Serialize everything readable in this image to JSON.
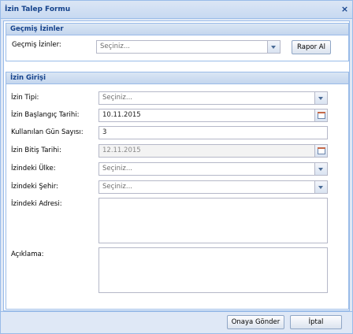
{
  "window": {
    "title": "İzin Talep Formu",
    "close_glyph": "×"
  },
  "past": {
    "section_title": "Geçmiş İzinler",
    "label": "Geçmiş İzinler:",
    "placeholder": "Seçiniz...",
    "report_button": "Rapor Al"
  },
  "entry": {
    "section_title": "İzin Girişi",
    "leave_type_label": "İzin Tipi:",
    "leave_type_value": "Seçiniz...",
    "start_date_label": "İzin Başlangıç Tarihi:",
    "start_date_value": "10.11.2015",
    "days_label": "Kullanılan Gün Sayısı:",
    "days_value": "3",
    "end_date_label": "İzin Bitiş Tarihi:",
    "end_date_value": "12.11.2015",
    "country_label": "İzindeki Ülke:",
    "country_value": "Seçiniz...",
    "city_label": "İzindeki Şehir:",
    "city_value": "Seçiniz...",
    "address_label": "İzindeki Adresi:",
    "address_value": "",
    "note_label": "Açıklama:",
    "note_value": ""
  },
  "footer": {
    "submit_button": "Onaya Gönder",
    "cancel_button": "İptal"
  }
}
